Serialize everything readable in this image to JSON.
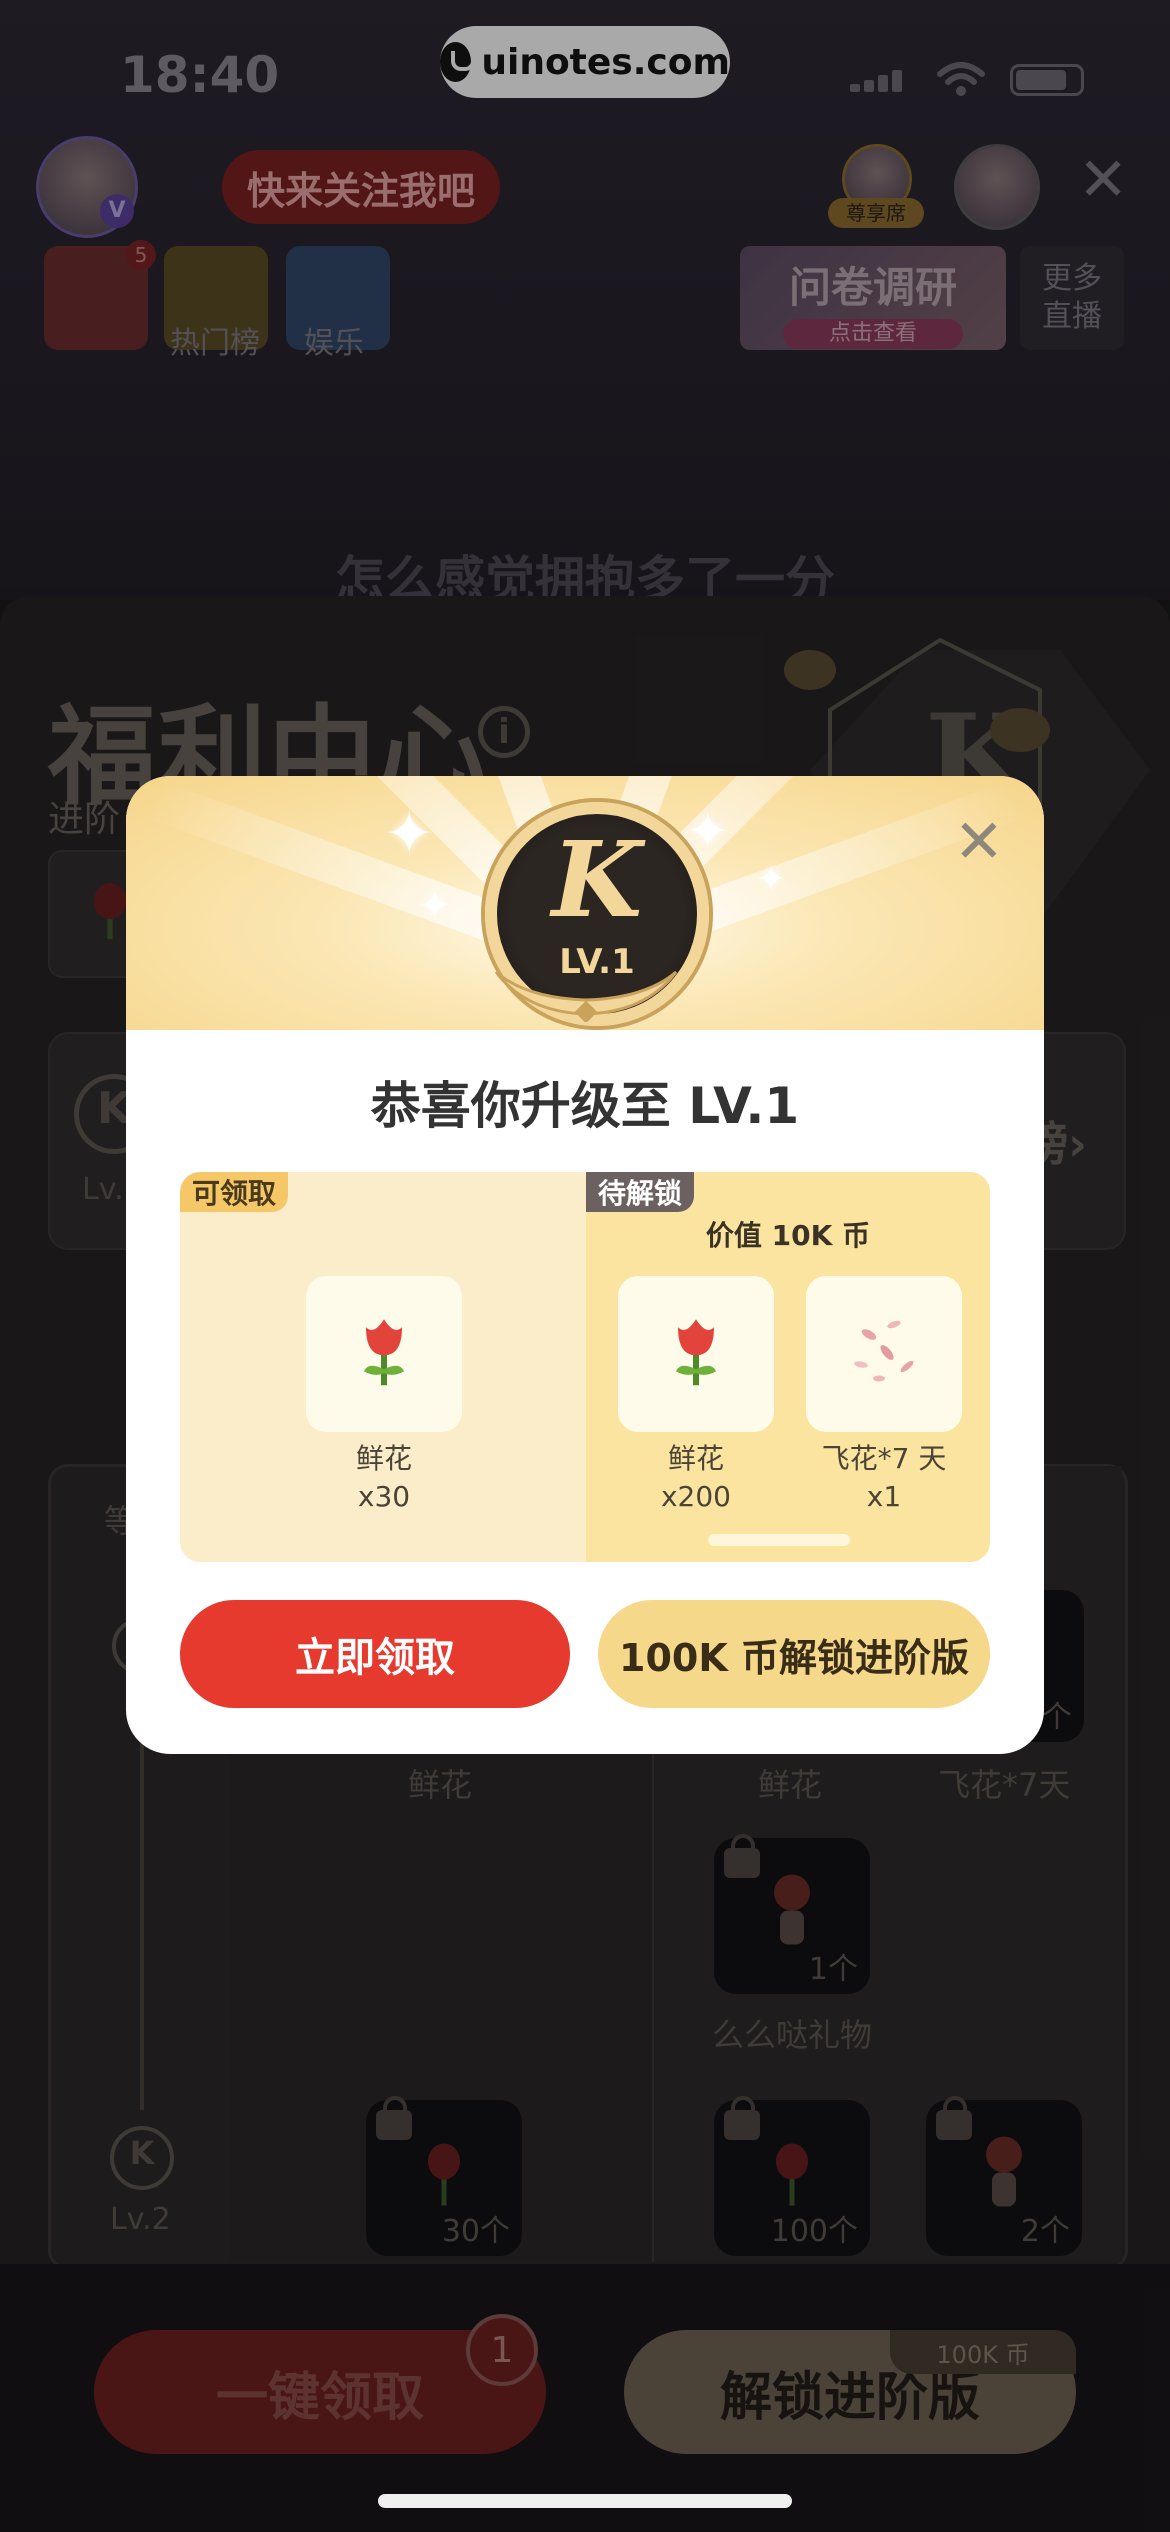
{
  "status_bar": {
    "time": "18:40"
  },
  "watermark": {
    "text": "uinotes.com"
  },
  "live": {
    "follow_label": "快来关注我吧",
    "vip_seat_label": "尊享席",
    "gift_count_badge": "5",
    "hot_rank_label": "热门榜",
    "entertainment_label": "娱乐",
    "survey_title": "问卷调研",
    "survey_sub": "点击查看",
    "more_live": "更多直播",
    "caption": "怎么感觉拥抱多了一分"
  },
  "welfare": {
    "title": "福利中心",
    "subtitle": "进阶",
    "rank_hint": "榜",
    "level_badge_small": "Lv.",
    "level_col_head": "等",
    "lv2_label": "Lv.2",
    "cols": {
      "flower_a": "鲜花",
      "flower_b": "鲜花",
      "fly_flower": "飞花*7天",
      "memeda": "么么哒礼物"
    },
    "gift_counts": {
      "g1": "1个",
      "g2": "30个",
      "g3": "100个",
      "g4": "2个",
      "g5": "个"
    }
  },
  "bottom": {
    "claim_all": "一键领取",
    "claim_badge": "1",
    "unlock_advanced": "解锁进阶版",
    "price_tag": "100K 币"
  },
  "modal": {
    "medal_letter": "K",
    "medal_level": "LV.1",
    "title": "恭喜你升级至 LV.1",
    "tag_claimable": "可领取",
    "tag_locked": "待解锁",
    "value_text": "价值 10K 币",
    "free_item": {
      "name": "鲜花",
      "qty": "x30"
    },
    "locked_items": [
      {
        "name": "鲜花",
        "qty": "x200"
      },
      {
        "name": "飞花*7 天",
        "qty": "x1"
      }
    ],
    "btn_claim": "立即领取",
    "btn_unlock": "100K 币解锁进阶版"
  },
  "colors": {
    "accent_red": "#e63a2e",
    "gold": "#f6d88a"
  }
}
